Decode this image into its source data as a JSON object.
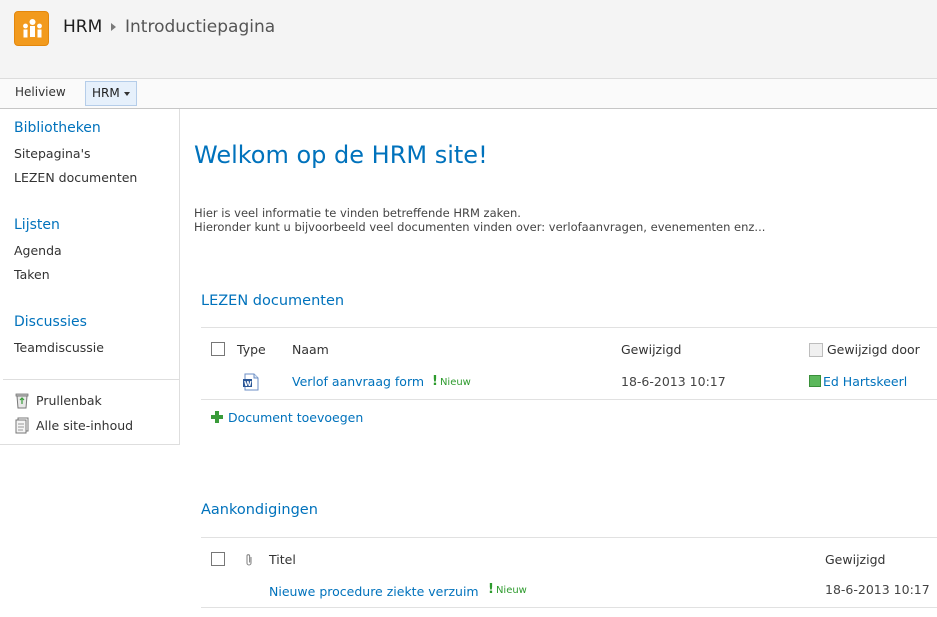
{
  "header": {
    "site_title": "HRM",
    "page_title": "Introductiepagina",
    "logo_icon": "people-group-icon",
    "accent": "#f29a1d"
  },
  "topnav": {
    "home": "Heliview",
    "current": "HRM"
  },
  "leftnav": {
    "groups": [
      {
        "heading": "Bibliotheken",
        "items": [
          "Sitepagina's",
          "LEZEN documenten"
        ]
      },
      {
        "heading": "Lijsten",
        "items": [
          "Agenda",
          "Taken"
        ]
      },
      {
        "heading": "Discussies",
        "items": [
          "Teamdiscussie"
        ]
      }
    ],
    "utilities": [
      {
        "label": "Prullenbak",
        "icon": "recycle-bin-icon"
      },
      {
        "label": "Alle site-inhoud",
        "icon": "site-content-icon"
      }
    ]
  },
  "main": {
    "welcome": "Welkom op de HRM site!",
    "intro_line1": "Hier is veel informatie te vinden betreffende HRM zaken.",
    "intro_line2": "Hieronder kunt u bijvoorbeeld veel documenten vinden over: verlofaanvragen, evenementen enz...",
    "documents": {
      "title": "LEZEN documenten",
      "columns": [
        "Type",
        "Naam",
        "Gewijzigd",
        "Gewijzigd door"
      ],
      "rows": [
        {
          "type_icon": "word-document-icon",
          "name": "Verlof aanvraag form",
          "badge": "Nieuw",
          "modified": "18-6-2013 10:17",
          "modified_by": "Ed Hartskeerl"
        }
      ],
      "add_label": "Document toevoegen"
    },
    "announcements": {
      "title": "Aankondigingen",
      "columns": [
        "Titel",
        "Gewijzigd"
      ],
      "rows": [
        {
          "title": "Nieuwe procedure ziekte verzuim",
          "badge": "Nieuw",
          "modified": "18-6-2013 10:17"
        }
      ]
    },
    "new_marker": "!"
  }
}
